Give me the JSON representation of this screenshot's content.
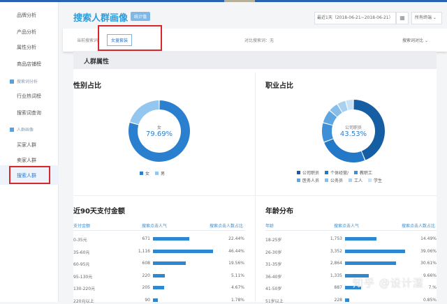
{
  "sidebar": {
    "items": [
      {
        "label": "品牌分析",
        "type": "item"
      },
      {
        "label": "产品分析",
        "type": "item"
      },
      {
        "label": "属性分析",
        "type": "item"
      },
      {
        "label": "商品店铺榜",
        "type": "item"
      },
      {
        "label": "搜索词分析",
        "type": "group"
      },
      {
        "label": "行业热词榜",
        "type": "item"
      },
      {
        "label": "搜索词查询",
        "type": "item"
      },
      {
        "label": "人群画像",
        "type": "group"
      },
      {
        "label": "买家人群",
        "type": "item"
      },
      {
        "label": "卖家人群",
        "type": "item"
      },
      {
        "label": "搜索人群",
        "type": "item",
        "active": true
      }
    ]
  },
  "header": {
    "title": "搜索人群画像",
    "badge": "统计值",
    "date_range": "最近1天（2018-06-21~2018-06-21）",
    "terminal": "所有终端 ⌄"
  },
  "filter": {
    "label": "当前搜索词：",
    "keyword": "女童套装",
    "compare": "对比搜索词：无",
    "compare_dropdown": "搜索词对比"
  },
  "section": {
    "title": "人群属性"
  },
  "gender": {
    "title": "性别占比",
    "center_label": "女",
    "center_value": "79.69%",
    "slices": [
      {
        "name": "女",
        "value": 79.69,
        "color": "#2a7fcf"
      },
      {
        "name": "男",
        "value": 20.31,
        "color": "#94c7ef"
      }
    ]
  },
  "occupation": {
    "title": "职业占比",
    "center_label": "公司职员",
    "center_value": "43.53%",
    "slices": [
      {
        "name": "公司职员",
        "value": 43.53,
        "color": "#155ea4"
      },
      {
        "name": "个体经营/",
        "value": 25,
        "color": "#2378c8"
      },
      {
        "name": "教职工",
        "value": 10,
        "color": "#3d8fd8"
      },
      {
        "name": "医务人员",
        "value": 7,
        "color": "#5ea6e2"
      },
      {
        "name": "公务员",
        "value": 5,
        "color": "#86bde9"
      },
      {
        "name": "工人",
        "value": 4.5,
        "color": "#a9d0f0"
      },
      {
        "name": "学生",
        "value": 4,
        "color": "#c9e2f6"
      }
    ]
  },
  "pay": {
    "title": "近90天支付金额",
    "headers": [
      "支付金额",
      "搜索点击人气",
      "搜索点击人数占比"
    ],
    "max": 1116,
    "rows": [
      [
        "0-35元",
        "671",
        671,
        "22.44%"
      ],
      [
        "35-60元",
        "1,116",
        1116,
        "46.44%"
      ],
      [
        "60-95元",
        "608",
        608,
        "19.56%"
      ],
      [
        "95-130元",
        "220",
        220,
        "5.11%"
      ],
      [
        "130-220元",
        "205",
        205,
        "4.67%"
      ],
      [
        "220元以上",
        "90",
        90,
        "1.78%"
      ]
    ]
  },
  "age": {
    "title": "年龄分布",
    "headers": [
      "年龄",
      "搜索点击人气",
      "搜索点击人数占比"
    ],
    "max": 3352,
    "rows": [
      [
        "18-25岁",
        "1,753",
        1753,
        "14.49%"
      ],
      [
        "26-30岁",
        "3,352",
        3352,
        "39.06%"
      ],
      [
        "31-35岁",
        "2,864",
        2864,
        "30.61%"
      ],
      [
        "36-40岁",
        "1,335",
        1335,
        "9.66%"
      ],
      [
        "41-50岁",
        "887",
        887,
        "7.%"
      ],
      [
        "51岁以上",
        "228",
        228,
        "0.85%"
      ]
    ]
  },
  "watermark": "知乎 @设计湿"
}
